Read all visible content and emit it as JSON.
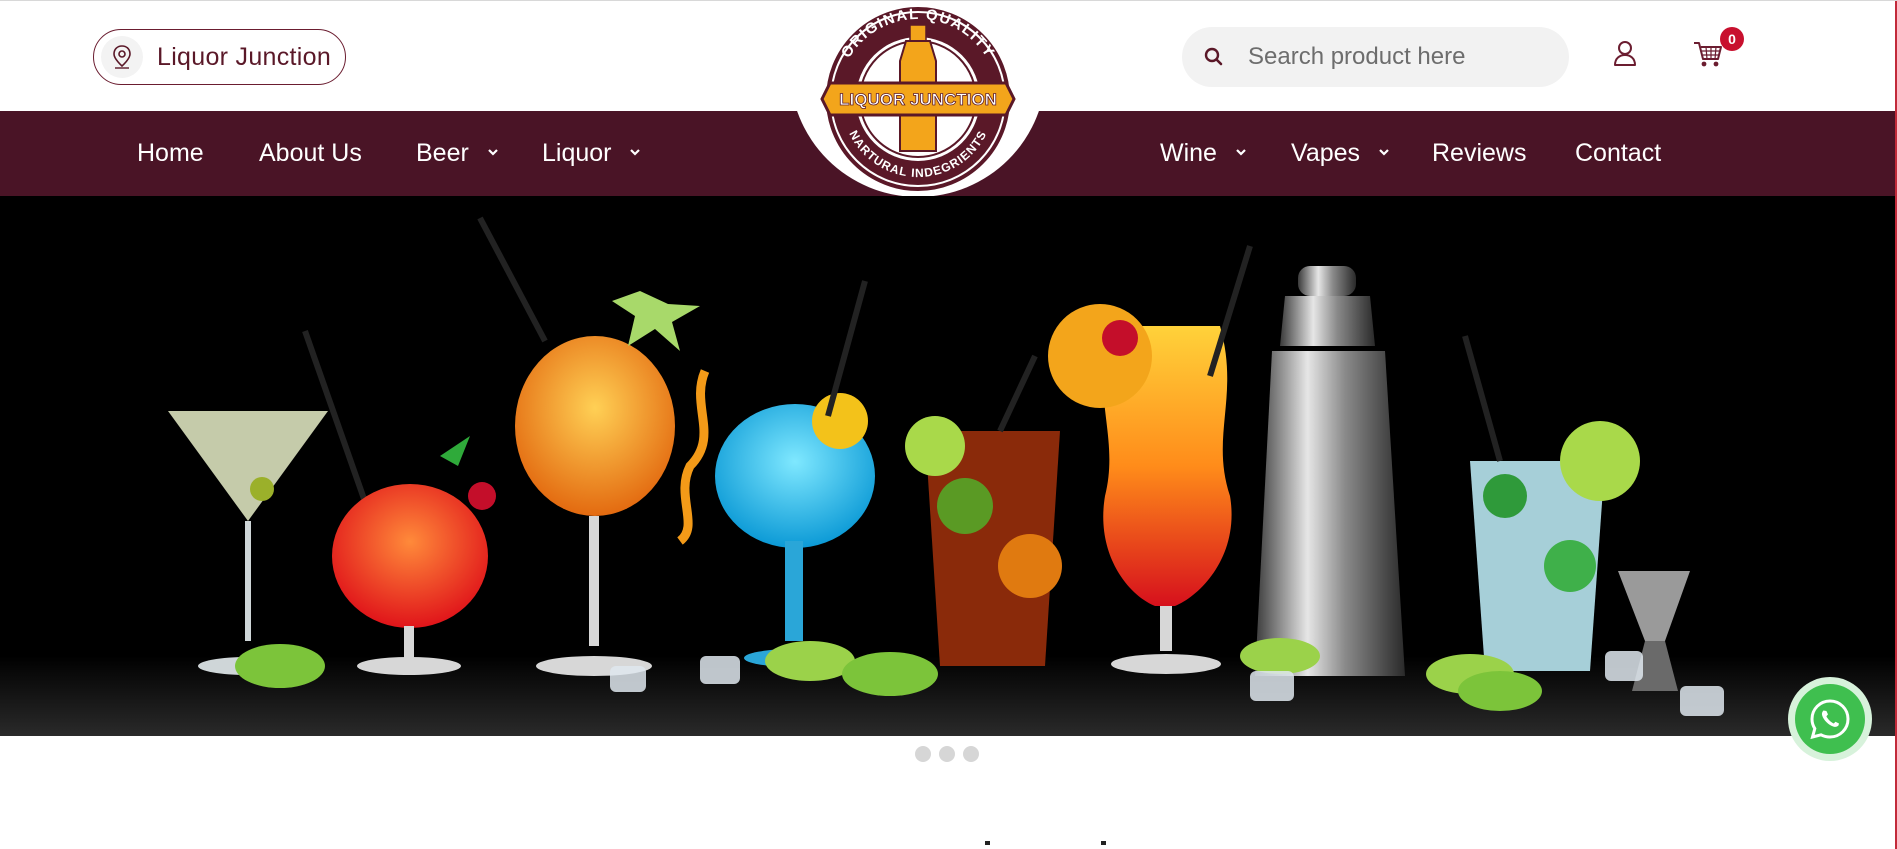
{
  "header": {
    "store_label": "Liquor Junction",
    "search_placeholder": "Search product here",
    "cart_count": "0"
  },
  "logo": {
    "top_text": "ORIGINAL QUALITY",
    "center_text": "LIQUOR JUNCTION",
    "bottom_text": "NARTURAL INDEGRIENTS"
  },
  "nav": {
    "left": [
      {
        "label": "Home",
        "dropdown": false
      },
      {
        "label": "About Us",
        "dropdown": false
      },
      {
        "label": "Beer",
        "dropdown": true
      },
      {
        "label": "Liquor",
        "dropdown": true
      }
    ],
    "right": [
      {
        "label": "Wine",
        "dropdown": true
      },
      {
        "label": "Vapes",
        "dropdown": true
      },
      {
        "label": "Reviews",
        "dropdown": false
      },
      {
        "label": "Contact",
        "dropdown": false
      }
    ]
  },
  "hero": {
    "image": "cocktail-glasses-banner",
    "slides": 3,
    "active_slide": 1
  },
  "icons": {
    "location": "location-pin-icon",
    "search": "search-icon",
    "user": "user-icon",
    "cart": "shopping-cart-icon",
    "whatsapp": "whatsapp-icon"
  },
  "colors": {
    "nav_bg": "#4a1426",
    "brand_text": "#5a1828",
    "badge": "#c8102e",
    "logo_gold": "#f3a51b",
    "whatsapp": "#3fbf4f"
  }
}
